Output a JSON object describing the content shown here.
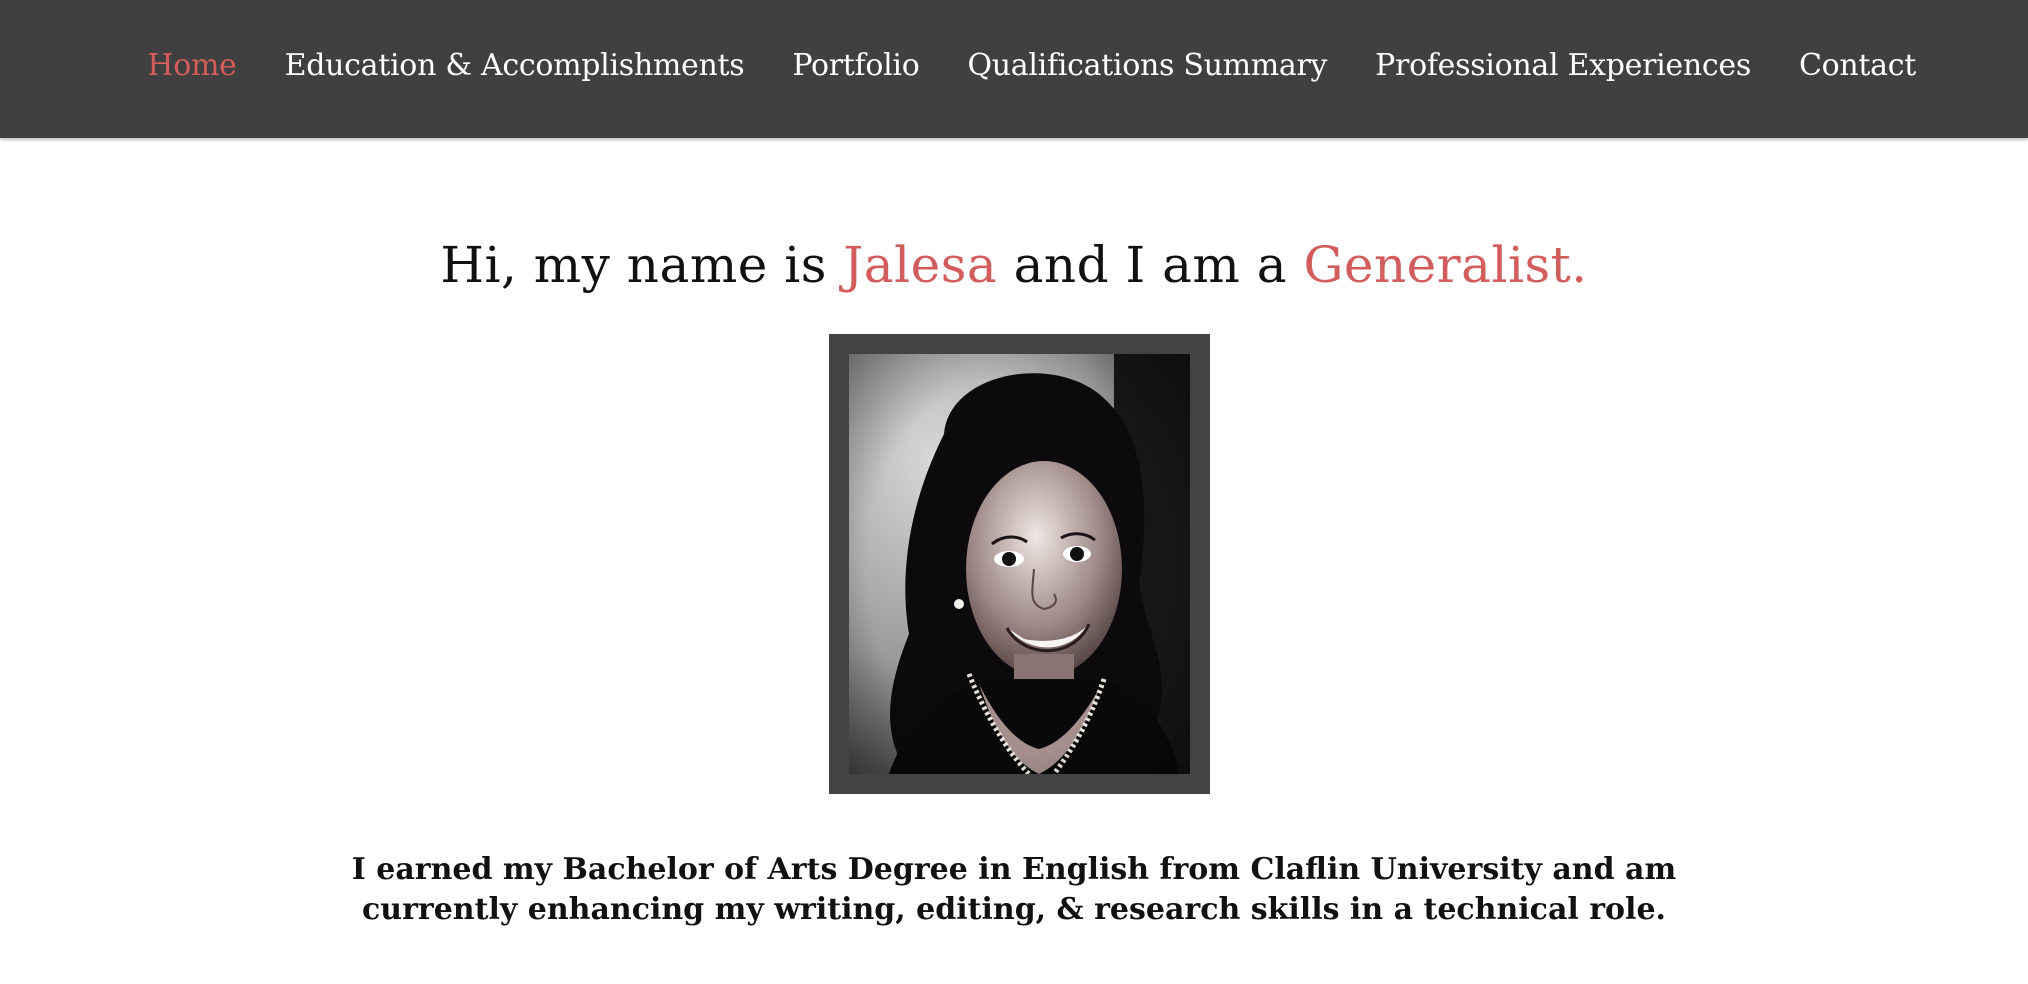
{
  "nav": {
    "items": [
      {
        "label": "Home",
        "active": true
      },
      {
        "label": "Education & Accomplishments",
        "active": false
      },
      {
        "label": "Portfolio",
        "active": false
      },
      {
        "label": "Qualifications Summary",
        "active": false
      },
      {
        "label": "Professional Experiences",
        "active": false
      },
      {
        "label": "Contact",
        "active": false
      }
    ]
  },
  "hero": {
    "heading_part1": "Hi, my name is ",
    "name": "Jalesa",
    "heading_part2": " and I am a ",
    "role": "Generalist."
  },
  "intro": {
    "line1": "I earned my Bachelor of Arts Degree in English from Claflin University and am",
    "line2": "currently enhancing my writing, editing, & research skills in a technical role."
  },
  "colors": {
    "accent": "#d35d5d",
    "nav_bg": "#404040",
    "frame": "#434343"
  }
}
